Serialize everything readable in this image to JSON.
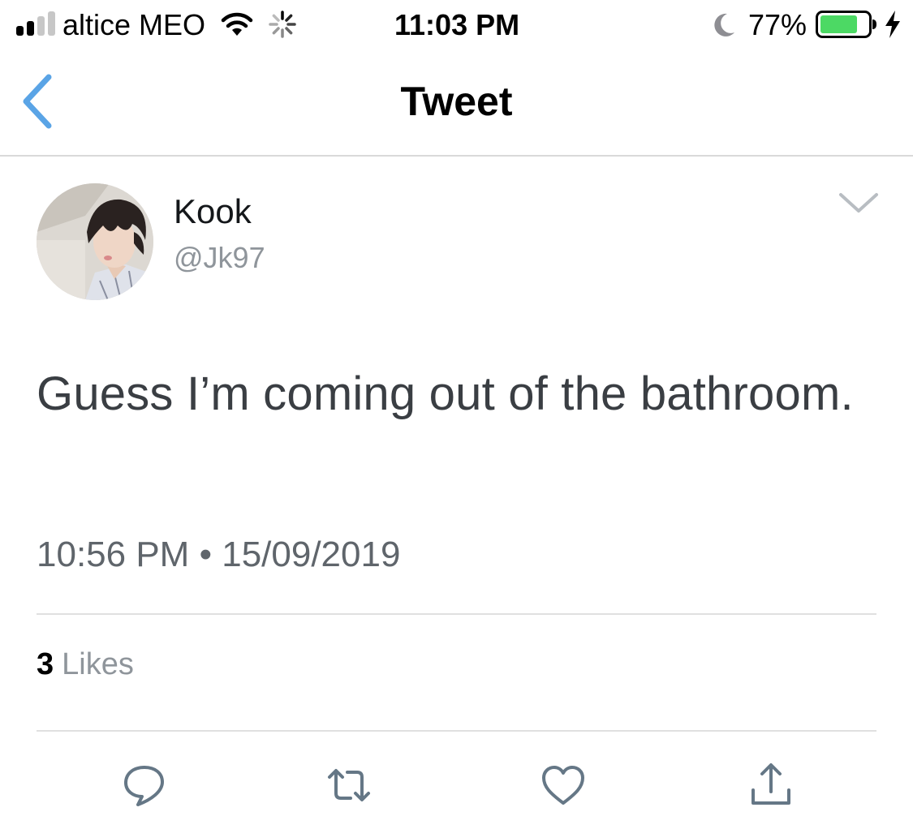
{
  "status_bar": {
    "carrier": "altice MEO",
    "time": "11:03 PM",
    "battery_percent": "77%",
    "battery_level": 0.77,
    "signal_bars_filled": 2,
    "signal_bars_total": 4,
    "icons": [
      "signal-icon",
      "wifi-icon",
      "activity-spinner-icon",
      "moon-icon",
      "battery-icon",
      "charging-bolt-icon"
    ],
    "battery_color": "#4cd964"
  },
  "nav": {
    "title": "Tweet",
    "back_icon": "chevron-left-icon",
    "accent_color": "#5aa4e6"
  },
  "tweet": {
    "display_name": "Kook",
    "handle": "@Jk97",
    "text": "Guess I’m coming out of the bathroom.",
    "time": "10:56 PM",
    "separator": "•",
    "date": "15/09/2019",
    "likes_count": "3",
    "likes_label": "Likes",
    "more_icon": "chevron-down-icon"
  },
  "actions": [
    {
      "name": "reply",
      "icon": "reply-bubble-icon"
    },
    {
      "name": "retweet",
      "icon": "retweet-icon"
    },
    {
      "name": "like",
      "icon": "heart-icon"
    },
    {
      "name": "share",
      "icon": "share-icon"
    }
  ]
}
